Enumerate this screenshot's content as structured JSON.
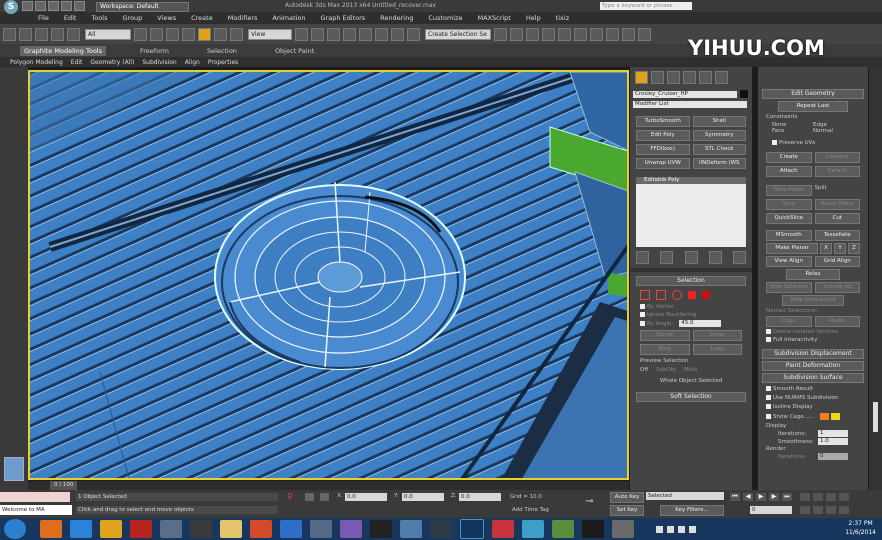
{
  "window": {
    "title": "Autodesk 3ds Max 2013 x64      Untitled_recover.max",
    "workspace": "Workspace: Default",
    "search_placeholder": "Type a keyword or phrase"
  },
  "watermark": {
    "text": "YIHUU.COM"
  },
  "menu": [
    "File",
    "Edit",
    "Tools",
    "Group",
    "Views",
    "Create",
    "Modifiers",
    "Animation",
    "Graph Editors",
    "Rendering",
    "Customize",
    "MAXScript",
    "Help",
    "tixiz"
  ],
  "toolbar": {
    "selection_filter": "All",
    "ref_coord": "View",
    "named_selection": "Create Selection Se"
  },
  "ribbon": {
    "tabs": [
      "Graphite Modeling Tools",
      "Freeform",
      "Selection",
      "Object Paint"
    ],
    "sub": [
      "Polygon Modeling",
      "Edit",
      "Geometry (All)",
      "Subdivision",
      "Align",
      "Properties"
    ]
  },
  "command_panel": {
    "object_name": "Crosley_Cruiser_HP",
    "modifier_list": "Modifier List",
    "mod_buttons": [
      "TurboSmooth",
      "Shell",
      "Edit Poly",
      "Symmetry",
      "FFD(box)",
      "STL Check",
      "Unwrap UVW",
      "lINDeform (WS"
    ],
    "stack_item": "Editable Poly",
    "selection": {
      "title": "Selection",
      "by_vertex": "By Vertex",
      "ignore_backfacing": "Ignore Backfacing",
      "by_angle": "By Angle:",
      "angle_value": "45.0",
      "shrink": "Shrink",
      "grow": "Grow",
      "ring": "Ring",
      "loop": "Loop",
      "preview_selection": "Preview Selection",
      "off": "Off",
      "subobj": "SubObj",
      "multi": "Multi",
      "status": "Whole Object Selected"
    },
    "soft_selection": "Soft Selection"
  },
  "edit_panel": {
    "edit_geometry": "Edit Geometry",
    "repeat_last": "Repeat Last",
    "constraints": "Constraints",
    "none": "None",
    "edge": "Edge",
    "face": "Face",
    "normal": "Normal",
    "preserve_uvs": "Preserve UVs",
    "create": "Create",
    "collapse": "Collapse",
    "attach": "Attach",
    "detach": "Detach",
    "slice_plane": "Slice Plane",
    "split": "Split",
    "slice": "Slice",
    "reset_plane": "Reset Plane",
    "quickslice": "QuickSlice",
    "cut": "Cut",
    "msmooth": "MSmooth",
    "tessellate": "Tessellate",
    "make_planar": "Make Planar",
    "x": "X",
    "y": "Y",
    "z": "Z",
    "view_align": "View Align",
    "grid_align": "Grid Align",
    "relax": "Relax",
    "hide_selected": "Hide Selected",
    "unhide_all": "Unhide All",
    "hide_unselected": "Hide Unselected",
    "named_selections": "Named Selections:",
    "copy": "Copy",
    "paste": "Paste",
    "delete_isolated": "Delete Isolated Vertices",
    "full_interactivity": "Full Interactivity",
    "subdivision_displacement": "Subdivision Displacement",
    "paint_deformation": "Paint Deformation",
    "subdivision_surface": "Subdivision Surface",
    "smooth_result": "Smooth Result",
    "use_nurms": "Use NURMS Subdivision",
    "isoline_display": "Isoline Display",
    "show_cage": "Show Cage......",
    "display": "Display",
    "iterations_label": "Iterations:",
    "iterations": "1",
    "smoothness_label": "Smoothness:",
    "smoothness": "1.0",
    "render": "Render",
    "render_iterations": "0"
  },
  "timeline": {
    "frame": "0 / 100"
  },
  "status": {
    "objects": "1 Object Selected",
    "prompt": "Click and drag to select and move objects",
    "x": "0.0",
    "y": "0.0",
    "z": "0.0",
    "grid": "Grid = 10.0",
    "add_time_tag": "Add Time Tag",
    "auto_key": "Auto Key",
    "set_key": "Set Key",
    "key_selected": "Selected",
    "key_filters": "Key Filters...",
    "frame": "0",
    "welcome": "Welcome to MA"
  },
  "clock": {
    "time": "2:37 PM",
    "date": "11/6/2014"
  },
  "colors": {
    "viewport_blue": "#3d7fc4",
    "active_border": "#e6d12a",
    "green_mesh": "#58a82a"
  }
}
